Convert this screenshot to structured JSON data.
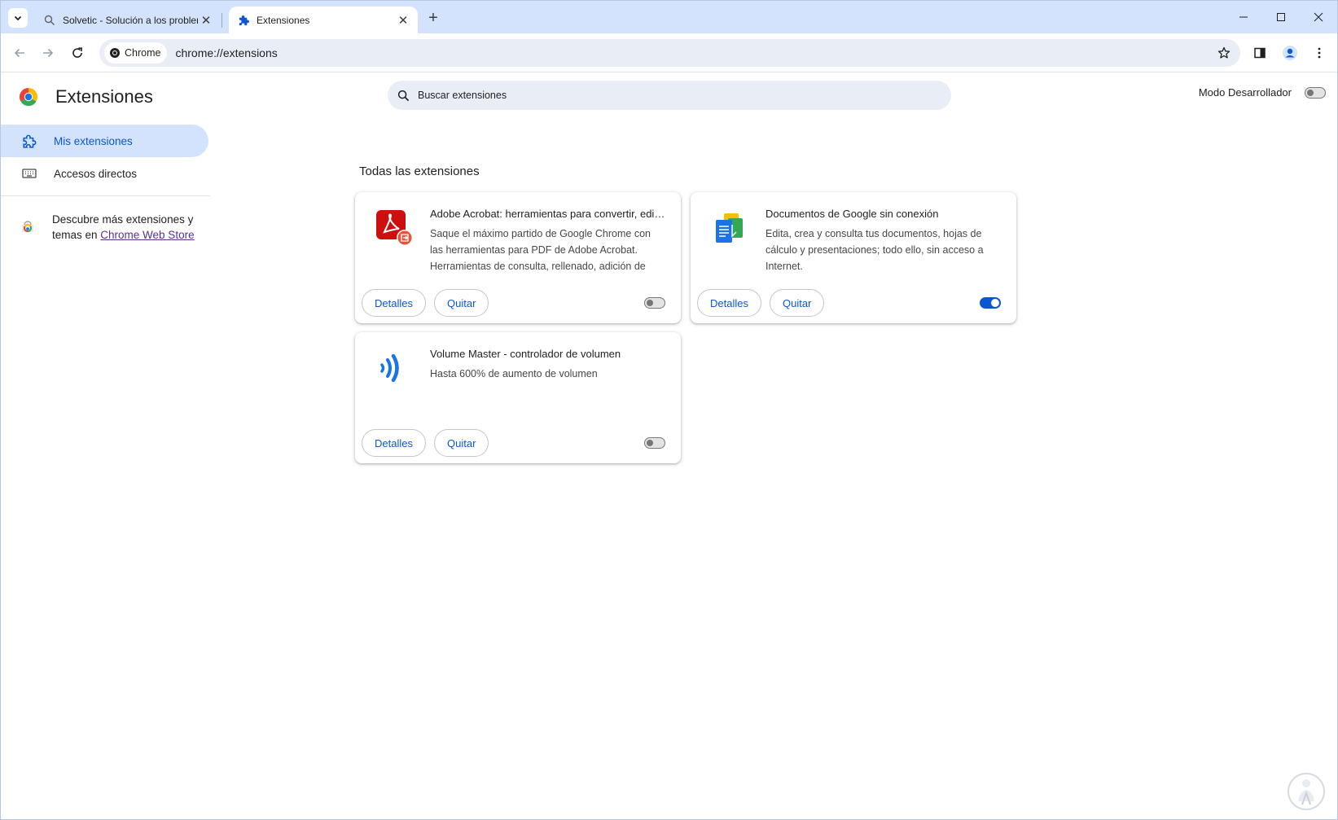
{
  "browser": {
    "tabs": [
      {
        "title": "Solvetic - Solución a los problemas",
        "active": false
      },
      {
        "title": "Extensiones",
        "active": true
      }
    ],
    "omnibox": {
      "chip_label": "Chrome",
      "url": "chrome://extensions"
    }
  },
  "page": {
    "title": "Extensiones",
    "search_placeholder": "Buscar extensiones",
    "dev_mode_label": "Modo Desarrollador",
    "dev_mode_enabled": false,
    "section_title": "Todas las extensiones"
  },
  "sidebar": {
    "items": [
      {
        "label": "Mis extensiones",
        "selected": true,
        "icon": "extension-puzzle-icon"
      },
      {
        "label": "Accesos directos",
        "selected": false,
        "icon": "keyboard-icon"
      }
    ],
    "webstore": {
      "text": "Descubre más extensiones y temas en ",
      "link": "Chrome Web Store"
    }
  },
  "extensions": [
    {
      "name": "Adobe Acrobat: herramientas para convertir, editar y firmar PDF",
      "description": "Saque el máximo partido de Google Chrome con las herramientas para PDF de Adobe Acrobat. Herramientas de consulta, rellenado, adición de",
      "enabled": false,
      "icon": "adobe-acrobat-icon",
      "details_label": "Detalles",
      "remove_label": "Quitar"
    },
    {
      "name": "Documentos de Google sin conexión",
      "description": "Edita, crea y consulta tus documentos, hojas de cálculo y presentaciones; todo ello, sin acceso a Internet.",
      "enabled": true,
      "icon": "google-docs-offline-icon",
      "details_label": "Detalles",
      "remove_label": "Quitar"
    },
    {
      "name": "Volume Master - controlador de volumen",
      "description": "Hasta 600% de aumento de volumen",
      "enabled": false,
      "icon": "volume-master-icon",
      "details_label": "Detalles",
      "remove_label": "Quitar"
    }
  ],
  "colors": {
    "accent": "#0b57d0",
    "tabstrip": "#d3e3fd",
    "omnibox": "#e9eef6"
  }
}
